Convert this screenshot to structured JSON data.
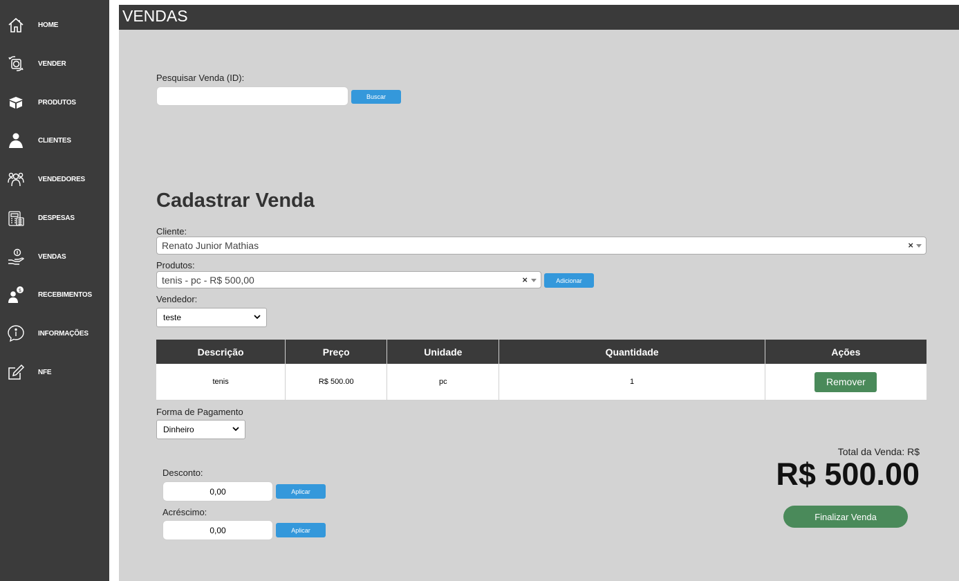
{
  "sidebar": {
    "items": [
      {
        "label": "HOME",
        "icon": "home-icon"
      },
      {
        "label": "VENDER",
        "icon": "money-transfer-icon"
      },
      {
        "label": "PRODUTOS",
        "icon": "box-icon"
      },
      {
        "label": "CLIENTES",
        "icon": "user-icon"
      },
      {
        "label": "VENDEDORES",
        "icon": "team-icon"
      },
      {
        "label": "DESPESAS",
        "icon": "calculator-icon"
      },
      {
        "label": "VENDAS",
        "icon": "hand-coin-icon"
      },
      {
        "label": "RECEBIMENTOS",
        "icon": "receive-money-icon"
      },
      {
        "label": "INFORMAÇÕES",
        "icon": "info-icon"
      },
      {
        "label": "NFE",
        "icon": "edit-icon"
      }
    ]
  },
  "header": {
    "title": "VENDAS"
  },
  "search": {
    "label": "Pesquisar Venda (ID):",
    "value": "",
    "button": "Buscar"
  },
  "form": {
    "heading": "Cadastrar Venda",
    "cliente_label": "Cliente:",
    "cliente_value": "Renato Junior Mathias",
    "produtos_label": "Produtos:",
    "produtos_value": "tenis - pc - R$ 500,00",
    "adicionar_button": "Adicionar",
    "vendedor_label": "Vendedor:",
    "vendedor_value": "teste",
    "clear_symbol": "×"
  },
  "table": {
    "headers": [
      "Descrição",
      "Preço",
      "Unidade",
      "Quantidade",
      "Ações"
    ],
    "rows": [
      {
        "descricao": "tenis",
        "preco": "R$ 500.00",
        "unidade": "pc",
        "quantidade": "1",
        "acao": "Remover"
      }
    ]
  },
  "payment": {
    "label": "Forma de Pagamento",
    "value": "Dinheiro"
  },
  "desconto": {
    "label": "Desconto:",
    "value": "0,00",
    "button": "Aplicar"
  },
  "acrescimo": {
    "label": "Acréscimo:",
    "value": "0,00",
    "button": "Aplicar"
  },
  "total": {
    "label": "Total da Venda: R$",
    "value": "R$ 500.00",
    "button": "Finalizar Venda"
  },
  "colors": {
    "sidebar": "#3b3b3b",
    "topbar": "#3a3a3a",
    "content": "#d3d3d3",
    "accent_blue": "#3498db",
    "accent_green": "#4a8a5a"
  }
}
